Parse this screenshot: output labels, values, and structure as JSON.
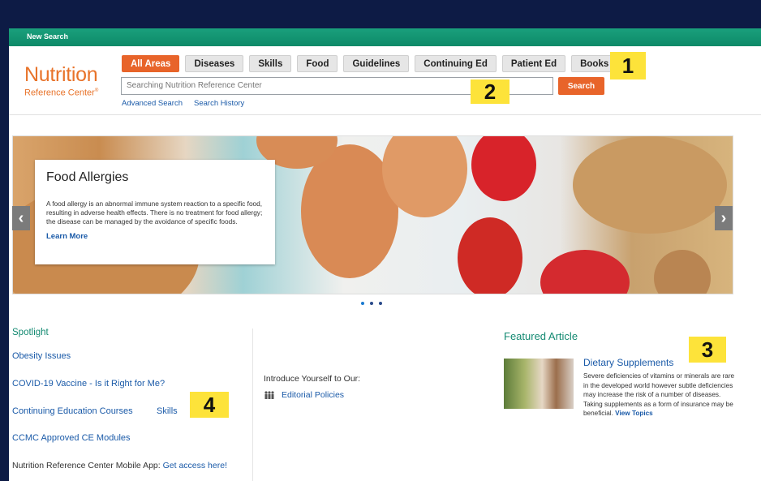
{
  "topbar": {
    "new_search": "New Search"
  },
  "logo": {
    "line1": "Nutrition",
    "line2": "Reference Center",
    "trademark": "®"
  },
  "tabs": [
    {
      "label": "All Areas",
      "active": true
    },
    {
      "label": "Diseases"
    },
    {
      "label": "Skills"
    },
    {
      "label": "Food"
    },
    {
      "label": "Guidelines"
    },
    {
      "label": "Continuing Ed"
    },
    {
      "label": "Patient Ed"
    },
    {
      "label": "Books"
    }
  ],
  "search": {
    "placeholder": "Searching Nutrition Reference Center",
    "button": "Search",
    "advanced": "Advanced Search",
    "history": "Search History"
  },
  "badges": {
    "b1": "1",
    "b2": "2",
    "b3": "3",
    "b4": "4"
  },
  "hero": {
    "title": "Food Allergies",
    "body": "A food allergy is an abnormal immune system reaction to a specific food, resulting in adverse health effects. There is no treatment for food allergy; the disease can be managed by the avoidance of specific foods.",
    "more": "Learn More",
    "prev": "‹",
    "next": "›"
  },
  "spotlight": {
    "title": "Spotlight",
    "links": [
      "Obesity Issues",
      "COVID-19 Vaccine - Is it Right for Me?",
      "Continuing Education Courses",
      "Skills",
      "CCMC Approved CE Modules"
    ],
    "mobile_text": "Nutrition Reference Center Mobile App: ",
    "mobile_link": "Get access here!"
  },
  "intro": {
    "text": "Introduce Yourself to Our:",
    "link": "Editorial Policies"
  },
  "featured": {
    "title": "Featured Article",
    "headline": "Dietary Supplements",
    "text": "Severe deficiencies of vitamins or minerals are rare in the developed world however subtle deficiencies may increase the risk of a number of diseases. Taking supplements as a form of insurance may be beneficial. ",
    "link": "View Topics"
  },
  "colors": {
    "accent": "#e8642a",
    "brand_green": "#148a72",
    "link": "#1a5aa8",
    "badge": "#fde33a"
  }
}
